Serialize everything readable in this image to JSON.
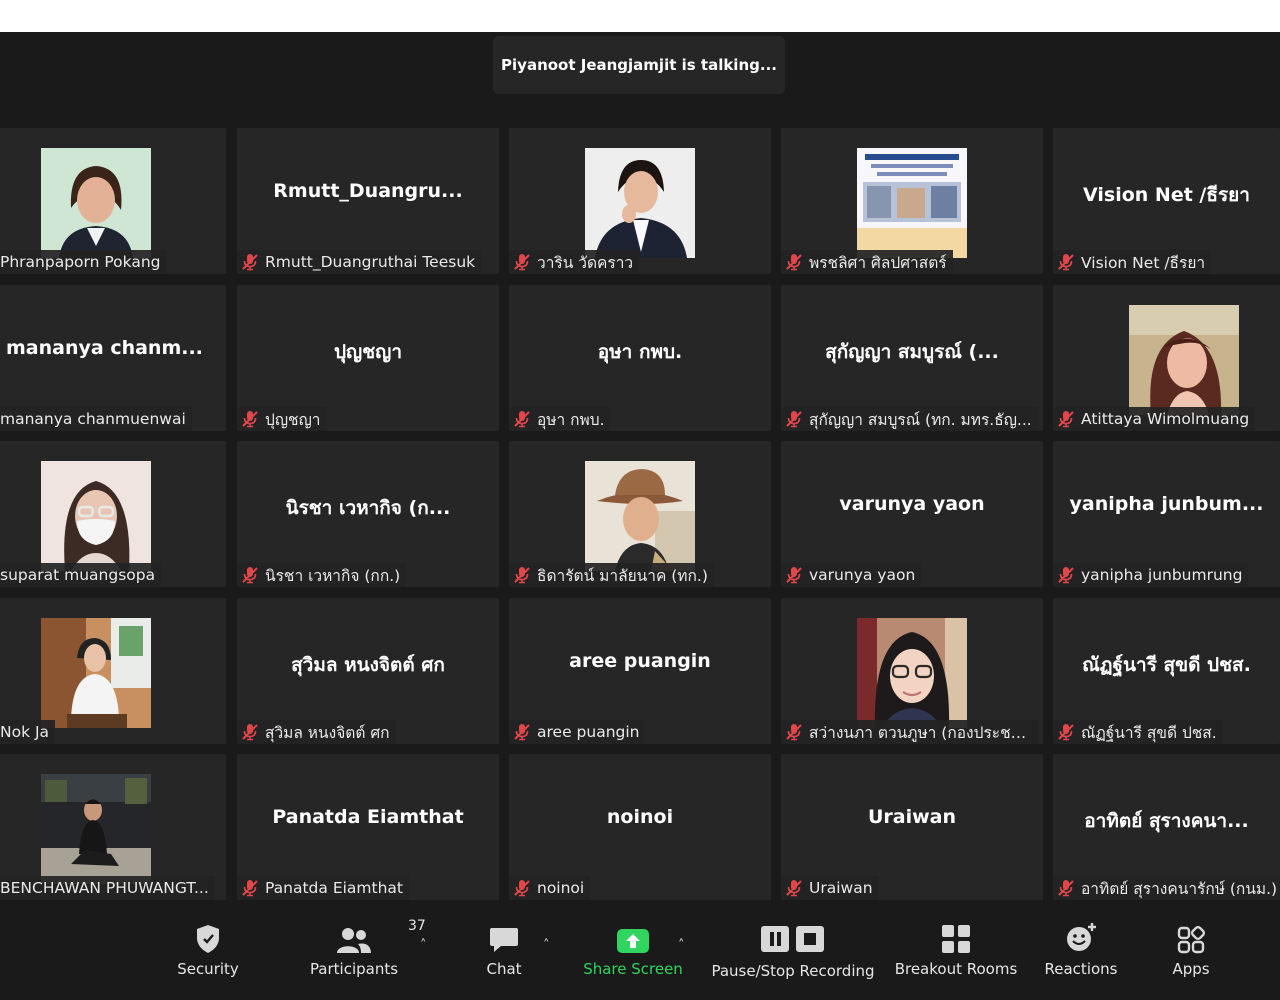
{
  "speaker_banner": "Piyanoot Jeangjamjit is talking...",
  "tiles": [
    {
      "display": "",
      "name": "Phranpaporn Pokang",
      "muted": false,
      "photo": "woman-portrait"
    },
    {
      "display": "Rmutt_Duangru...",
      "name": "Rmutt_Duangruthai Teesuk",
      "muted": true,
      "photo": ""
    },
    {
      "display": "",
      "name": "วาริน วัดคราว",
      "muted": true,
      "photo": "woman-business-portrait"
    },
    {
      "display": "",
      "name": "พรชลิศา ศิลปศาสตร์",
      "muted": true,
      "photo": "poster-thumbnail"
    },
    {
      "display": "Vision Net /ธีรยา",
      "name": "Vision Net /ธีรยา",
      "muted": true,
      "photo": ""
    },
    {
      "display": "mananya chanm...",
      "name": "mananya chanmuenwai",
      "muted": false,
      "photo": ""
    },
    {
      "display": "ปุญชญา",
      "name": "ปุญชญา",
      "muted": true,
      "photo": ""
    },
    {
      "display": "อุษา กพบ.",
      "name": "อุษา กพบ.",
      "muted": true,
      "photo": ""
    },
    {
      "display": "สุกัญญา สมบูรณ์ (...",
      "name": "สุกัญญา สมบูรณ์ (ทก. มทร.ธัญ...",
      "muted": true,
      "photo": ""
    },
    {
      "display": "",
      "name": "Atittaya Wimolmuang",
      "muted": true,
      "photo": "woman-selfie"
    },
    {
      "display": "",
      "name": "suparat muangsopa",
      "muted": false,
      "photo": "woman-mask"
    },
    {
      "display": "นิรชา เวหากิจ (ก...",
      "name": "นิรชา เวหากิจ (กก.)",
      "muted": true,
      "photo": ""
    },
    {
      "display": "",
      "name": "ธิดารัตน์ มาลัยนาค (ทก.)",
      "muted": true,
      "photo": "woman-hat"
    },
    {
      "display": "varunya yaon",
      "name": "varunya yaon",
      "muted": true,
      "photo": ""
    },
    {
      "display": "yanipha junbum...",
      "name": "yanipha junbumrung",
      "muted": true,
      "photo": ""
    },
    {
      "display": "",
      "name": "Nok Ja",
      "muted": false,
      "photo": "woman-sitting"
    },
    {
      "display": "สุวิมล หนงจิตต์ ศก",
      "name": "สุวิมล หนงจิตต์ ศก",
      "muted": true,
      "photo": ""
    },
    {
      "display": "aree puangin",
      "name": "aree puangin",
      "muted": true,
      "photo": ""
    },
    {
      "display": "",
      "name": "สว่างนภา ตวนภูษา (กองประชาสั...",
      "muted": true,
      "photo": "woman-glasses"
    },
    {
      "display": "ณัฏฐ์นารี สุขดี ปชส.",
      "name": "ณัฏฐ์นารี สุขดี ปชส.",
      "muted": true,
      "photo": ""
    },
    {
      "display": "",
      "name": "BENCHAWAN PHUWANGT...",
      "muted": false,
      "photo": "person-outdoor"
    },
    {
      "display": "Panatda Eiamthat",
      "name": "Panatda Eiamthat",
      "muted": true,
      "photo": ""
    },
    {
      "display": "noinoi",
      "name": "noinoi",
      "muted": true,
      "photo": ""
    },
    {
      "display": "Uraiwan",
      "name": "Uraiwan",
      "muted": true,
      "photo": ""
    },
    {
      "display": "อาทิตย์ สุรางคนา...",
      "name": "อาทิตย์ สุรางคนารักษ์ (กนม.)",
      "muted": true,
      "photo": ""
    }
  ],
  "toolbar": {
    "security": "Security",
    "participants": "Participants",
    "participants_count": "37",
    "chat": "Chat",
    "share": "Share Screen",
    "recording": "Pause/Stop Recording",
    "breakout": "Breakout Rooms",
    "reactions": "Reactions",
    "apps": "Apps"
  },
  "colors": {
    "background": "#1a1a1a",
    "tile": "#262626",
    "mute_red": "#e0474c",
    "share_green": "#2fd55f"
  }
}
